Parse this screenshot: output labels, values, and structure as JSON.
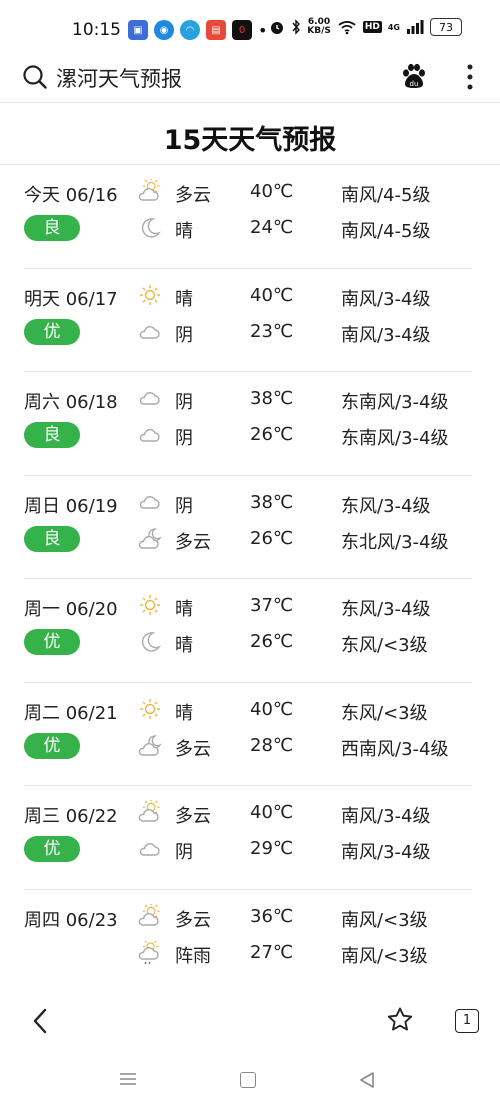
{
  "status": {
    "time": "10:15",
    "speed_value": "6.00",
    "speed_unit": "KB/S",
    "hd": "HD",
    "network": "4G",
    "battery": "73"
  },
  "search": {
    "query": "漯河天气预报"
  },
  "page": {
    "title": "15天天气预报"
  },
  "days": [
    {
      "date": "今天 06/16",
      "aqi": "良",
      "day": {
        "icon": "partly-cloudy-day-icon",
        "cond": "多云",
        "temp": "40℃",
        "wind": "南风/4-5级"
      },
      "night": {
        "icon": "moon-icon",
        "cond": "晴",
        "temp": "24℃",
        "wind": "南风/4-5级"
      }
    },
    {
      "date": "明天 06/17",
      "aqi": "优",
      "day": {
        "icon": "sun-icon",
        "cond": "晴",
        "temp": "40℃",
        "wind": "南风/3-4级"
      },
      "night": {
        "icon": "cloud-icon",
        "cond": "阴",
        "temp": "23℃",
        "wind": "南风/3-4级"
      }
    },
    {
      "date": "周六 06/18",
      "aqi": "良",
      "day": {
        "icon": "cloud-icon",
        "cond": "阴",
        "temp": "38℃",
        "wind": "东南风/3-4级"
      },
      "night": {
        "icon": "cloud-icon",
        "cond": "阴",
        "temp": "26℃",
        "wind": "东南风/3-4级"
      }
    },
    {
      "date": "周日 06/19",
      "aqi": "良",
      "day": {
        "icon": "cloud-icon",
        "cond": "阴",
        "temp": "38℃",
        "wind": "东风/3-4级"
      },
      "night": {
        "icon": "partly-cloudy-night-icon",
        "cond": "多云",
        "temp": "26℃",
        "wind": "东北风/3-4级"
      }
    },
    {
      "date": "周一 06/20",
      "aqi": "优",
      "day": {
        "icon": "sun-icon",
        "cond": "晴",
        "temp": "37℃",
        "wind": "东风/3-4级"
      },
      "night": {
        "icon": "moon-icon",
        "cond": "晴",
        "temp": "26℃",
        "wind": "东风/<3级"
      }
    },
    {
      "date": "周二 06/21",
      "aqi": "优",
      "day": {
        "icon": "sun-icon",
        "cond": "晴",
        "temp": "40℃",
        "wind": "东风/<3级"
      },
      "night": {
        "icon": "partly-cloudy-night-icon",
        "cond": "多云",
        "temp": "28℃",
        "wind": "西南风/3-4级"
      }
    },
    {
      "date": "周三 06/22",
      "aqi": "优",
      "day": {
        "icon": "partly-cloudy-day-icon",
        "cond": "多云",
        "temp": "40℃",
        "wind": "南风/3-4级"
      },
      "night": {
        "icon": "cloud-icon",
        "cond": "阴",
        "temp": "29℃",
        "wind": "南风/3-4级"
      }
    },
    {
      "date": "周四 06/23",
      "aqi": "",
      "day": {
        "icon": "partly-cloudy-day-icon",
        "cond": "多云",
        "temp": "36℃",
        "wind": "南风/<3级"
      },
      "night": {
        "icon": "shower-icon",
        "cond": "阵雨",
        "temp": "27℃",
        "wind": "南风/<3级"
      }
    }
  ],
  "bottom": {
    "tab_count": "1"
  },
  "colors": {
    "aqi_badge": "#36b24a",
    "sun": "#f0b53a",
    "cloud": "#aaaaaa",
    "rain": "#4a90d9"
  }
}
